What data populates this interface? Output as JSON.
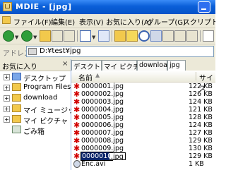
{
  "window": {
    "title": "MDIE - [jpg]"
  },
  "menubar": {
    "items": [
      {
        "label": "ファイル(F)"
      },
      {
        "label": "編集(E)"
      },
      {
        "label": "表示(V)"
      },
      {
        "label": "お気に入り(A)"
      },
      {
        "label": "グループ(G)"
      },
      {
        "label": "スクリプト(S)"
      }
    ]
  },
  "addressbar": {
    "label": "アドレス",
    "path": "D:¥test¥jpg"
  },
  "tree": {
    "header": "お気に入り",
    "close_glyph": "×",
    "nodes": [
      {
        "label": "デスクトップ",
        "expander": "+"
      },
      {
        "label": "Program Files",
        "expander": "+"
      },
      {
        "label": "download",
        "expander": "+"
      },
      {
        "label": "マイ ミュージック",
        "expander": "+"
      },
      {
        "label": "マイ ピクチャ",
        "expander": "+"
      },
      {
        "label": "ごみ箱",
        "expander": ""
      }
    ]
  },
  "tabs": [
    {
      "label": "デスクトップ"
    },
    {
      "label": "マイ ピクチャ"
    },
    {
      "label": "download"
    },
    {
      "label": "jpg"
    }
  ],
  "filelist": {
    "columns": {
      "name": "名前",
      "size": "サイズ",
      "sort_glyph": "▲"
    },
    "rows": [
      {
        "name": "0000001.jpg",
        "size": "122 KB"
      },
      {
        "name": "0000002.jpg",
        "size": "126 KB"
      },
      {
        "name": "0000003.jpg",
        "size": "124 KB"
      },
      {
        "name": "0000004.jpg",
        "size": "121 KB"
      },
      {
        "name": "0000005.jpg",
        "size": "128 KB"
      },
      {
        "name": "0000006.jpg",
        "size": "124 KB"
      },
      {
        "name": "0000007.jpg",
        "size": "127 KB"
      },
      {
        "name": "0000008.jpg",
        "size": "129 KB"
      },
      {
        "name": "0000009.jpg",
        "size": "130 KB"
      },
      {
        "name": "0000010",
        "ext": ".jpg",
        "size": "129 KB"
      },
      {
        "name": "Enc.avi",
        "size": "1 KB"
      }
    ]
  },
  "colors": {
    "titlebar": "#0a5fd8",
    "selection": "#0a246a",
    "jpg_icon": "#d10000"
  }
}
